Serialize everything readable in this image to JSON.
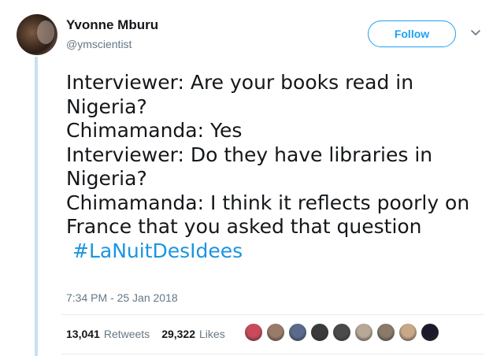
{
  "author": {
    "display_name": "Yvonne Mburu",
    "handle": "@ymscientist"
  },
  "follow_label": "Follow",
  "tweet": {
    "lines": [
      "Interviewer: Are your books read in",
      "Nigeria?",
      "Chimamanda: Yes",
      "Interviewer: Do they have libraries in",
      "Nigeria?",
      "Chimamanda: I think it reflects poorly on",
      "France that you asked that question"
    ],
    "hashtag": "#LaNuitDesIdees"
  },
  "timestamp": "7:34 PM - 25 Jan 2018",
  "stats": {
    "retweets_count": "13,041",
    "retweets_label": "Retweets",
    "likes_count": "29,322",
    "likes_label": "Likes"
  },
  "colors": {
    "accent": "#1da1f2",
    "hashtag": "#1b95e0",
    "muted": "#657786",
    "thread_line": "#c8e0f0"
  },
  "liker_avatar_colors": [
    "#c94a5a",
    "#9a7b6a",
    "#5a6a8a",
    "#3a3a3a",
    "#4a4a4a",
    "#b8a898",
    "#8a7a6a",
    "#c8a888",
    "#1a1a2a"
  ]
}
